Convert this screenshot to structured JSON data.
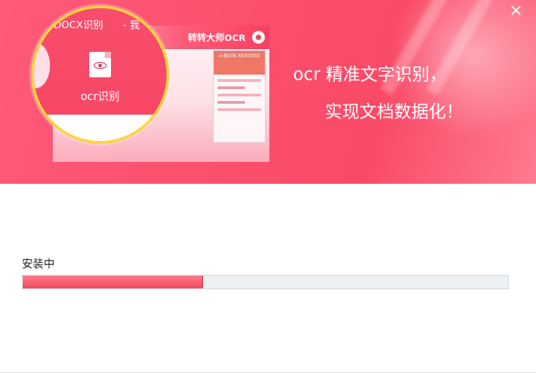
{
  "window": {
    "close_label": "×"
  },
  "banner": {
    "zoom_tab_text": "DOCX识别",
    "zoom_tab_text2": "- 我",
    "ocr_label": "ocr识别",
    "preview_title": "转转大师OCR",
    "preview_panel_title": "e-BOOK READERS",
    "slogan_line1": "ocr 精准文字识别，",
    "slogan_line2": "实现文档数据化！",
    "colors": {
      "banner": "#f94a67",
      "ring": "#ffd33d"
    }
  },
  "install": {
    "status": "安装中",
    "progress": 0.37,
    "colors": {
      "fill": "#f2485e",
      "track": "#edf0f3"
    }
  }
}
